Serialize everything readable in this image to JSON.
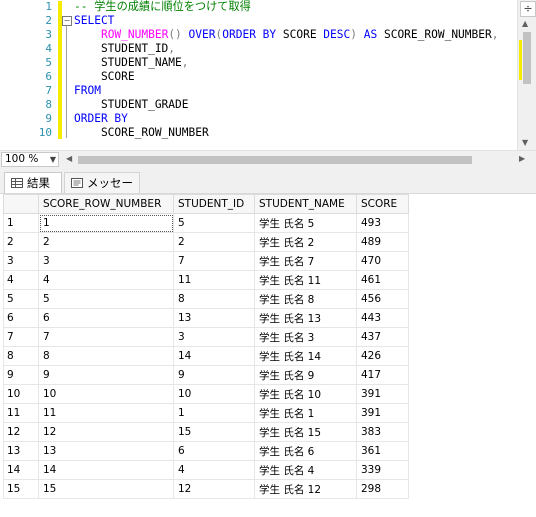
{
  "editor": {
    "line_numbers": [
      "1",
      "2",
      "3",
      "4",
      "5",
      "6",
      "7",
      "8",
      "9",
      "10"
    ],
    "lines": [
      [
        {
          "c": "cm",
          "t": "-- 学生の成績に順位をつけて取得"
        }
      ],
      [
        {
          "c": "kw",
          "t": "SELECT"
        }
      ],
      [
        {
          "c": "tx",
          "t": "    "
        },
        {
          "c": "fn",
          "t": "ROW_NUMBER"
        },
        {
          "c": "gray",
          "t": "()"
        },
        {
          "c": "tx",
          "t": " "
        },
        {
          "c": "kw",
          "t": "OVER"
        },
        {
          "c": "gray",
          "t": "("
        },
        {
          "c": "kw",
          "t": "ORDER BY"
        },
        {
          "c": "tx",
          "t": " SCORE "
        },
        {
          "c": "kw",
          "t": "DESC"
        },
        {
          "c": "gray",
          "t": ")"
        },
        {
          "c": "tx",
          "t": " "
        },
        {
          "c": "kw",
          "t": "AS"
        },
        {
          "c": "tx",
          "t": " SCORE_ROW_NUMBER"
        },
        {
          "c": "gray",
          "t": ","
        }
      ],
      [
        {
          "c": "tx",
          "t": "    STUDENT_ID"
        },
        {
          "c": "gray",
          "t": ","
        }
      ],
      [
        {
          "c": "tx",
          "t": "    STUDENT_NAME"
        },
        {
          "c": "gray",
          "t": ","
        }
      ],
      [
        {
          "c": "tx",
          "t": "    SCORE"
        }
      ],
      [
        {
          "c": "kw",
          "t": "FROM"
        }
      ],
      [
        {
          "c": "tx",
          "t": "    STUDENT_GRADE"
        }
      ],
      [
        {
          "c": "kw",
          "t": "ORDER BY"
        }
      ],
      [
        {
          "c": "tx",
          "t": "    SCORE_ROW_NUMBER"
        }
      ]
    ]
  },
  "zoom": {
    "value": "100 %"
  },
  "tabs": [
    {
      "label": "結果",
      "icon": "grid-icon",
      "active": true
    },
    {
      "label": "メッセージ",
      "icon": "message-icon",
      "active": false
    }
  ],
  "results": {
    "columns": [
      "SCORE_ROW_NUMBER",
      "STUDENT_ID",
      "STUDENT_NAME",
      "SCORE"
    ],
    "rows": [
      [
        "1",
        "1",
        "5",
        "学生 氏名 5",
        "493"
      ],
      [
        "2",
        "2",
        "2",
        "学生 氏名 2",
        "489"
      ],
      [
        "3",
        "3",
        "7",
        "学生 氏名 7",
        "470"
      ],
      [
        "4",
        "4",
        "11",
        "学生 氏名 11",
        "461"
      ],
      [
        "5",
        "5",
        "8",
        "学生 氏名 8",
        "456"
      ],
      [
        "6",
        "6",
        "13",
        "学生 氏名 13",
        "443"
      ],
      [
        "7",
        "7",
        "3",
        "学生 氏名 3",
        "437"
      ],
      [
        "8",
        "8",
        "14",
        "学生 氏名 14",
        "426"
      ],
      [
        "9",
        "9",
        "9",
        "学生 氏名 9",
        "417"
      ],
      [
        "10",
        "10",
        "10",
        "学生 氏名 10",
        "391"
      ],
      [
        "11",
        "11",
        "1",
        "学生 氏名 1",
        "391"
      ],
      [
        "12",
        "12",
        "15",
        "学生 氏名 15",
        "383"
      ],
      [
        "13",
        "13",
        "6",
        "学生 氏名 6",
        "361"
      ],
      [
        "14",
        "14",
        "4",
        "学生 氏名 4",
        "339"
      ],
      [
        "15",
        "15",
        "12",
        "学生 氏名 12",
        "298"
      ]
    ]
  }
}
